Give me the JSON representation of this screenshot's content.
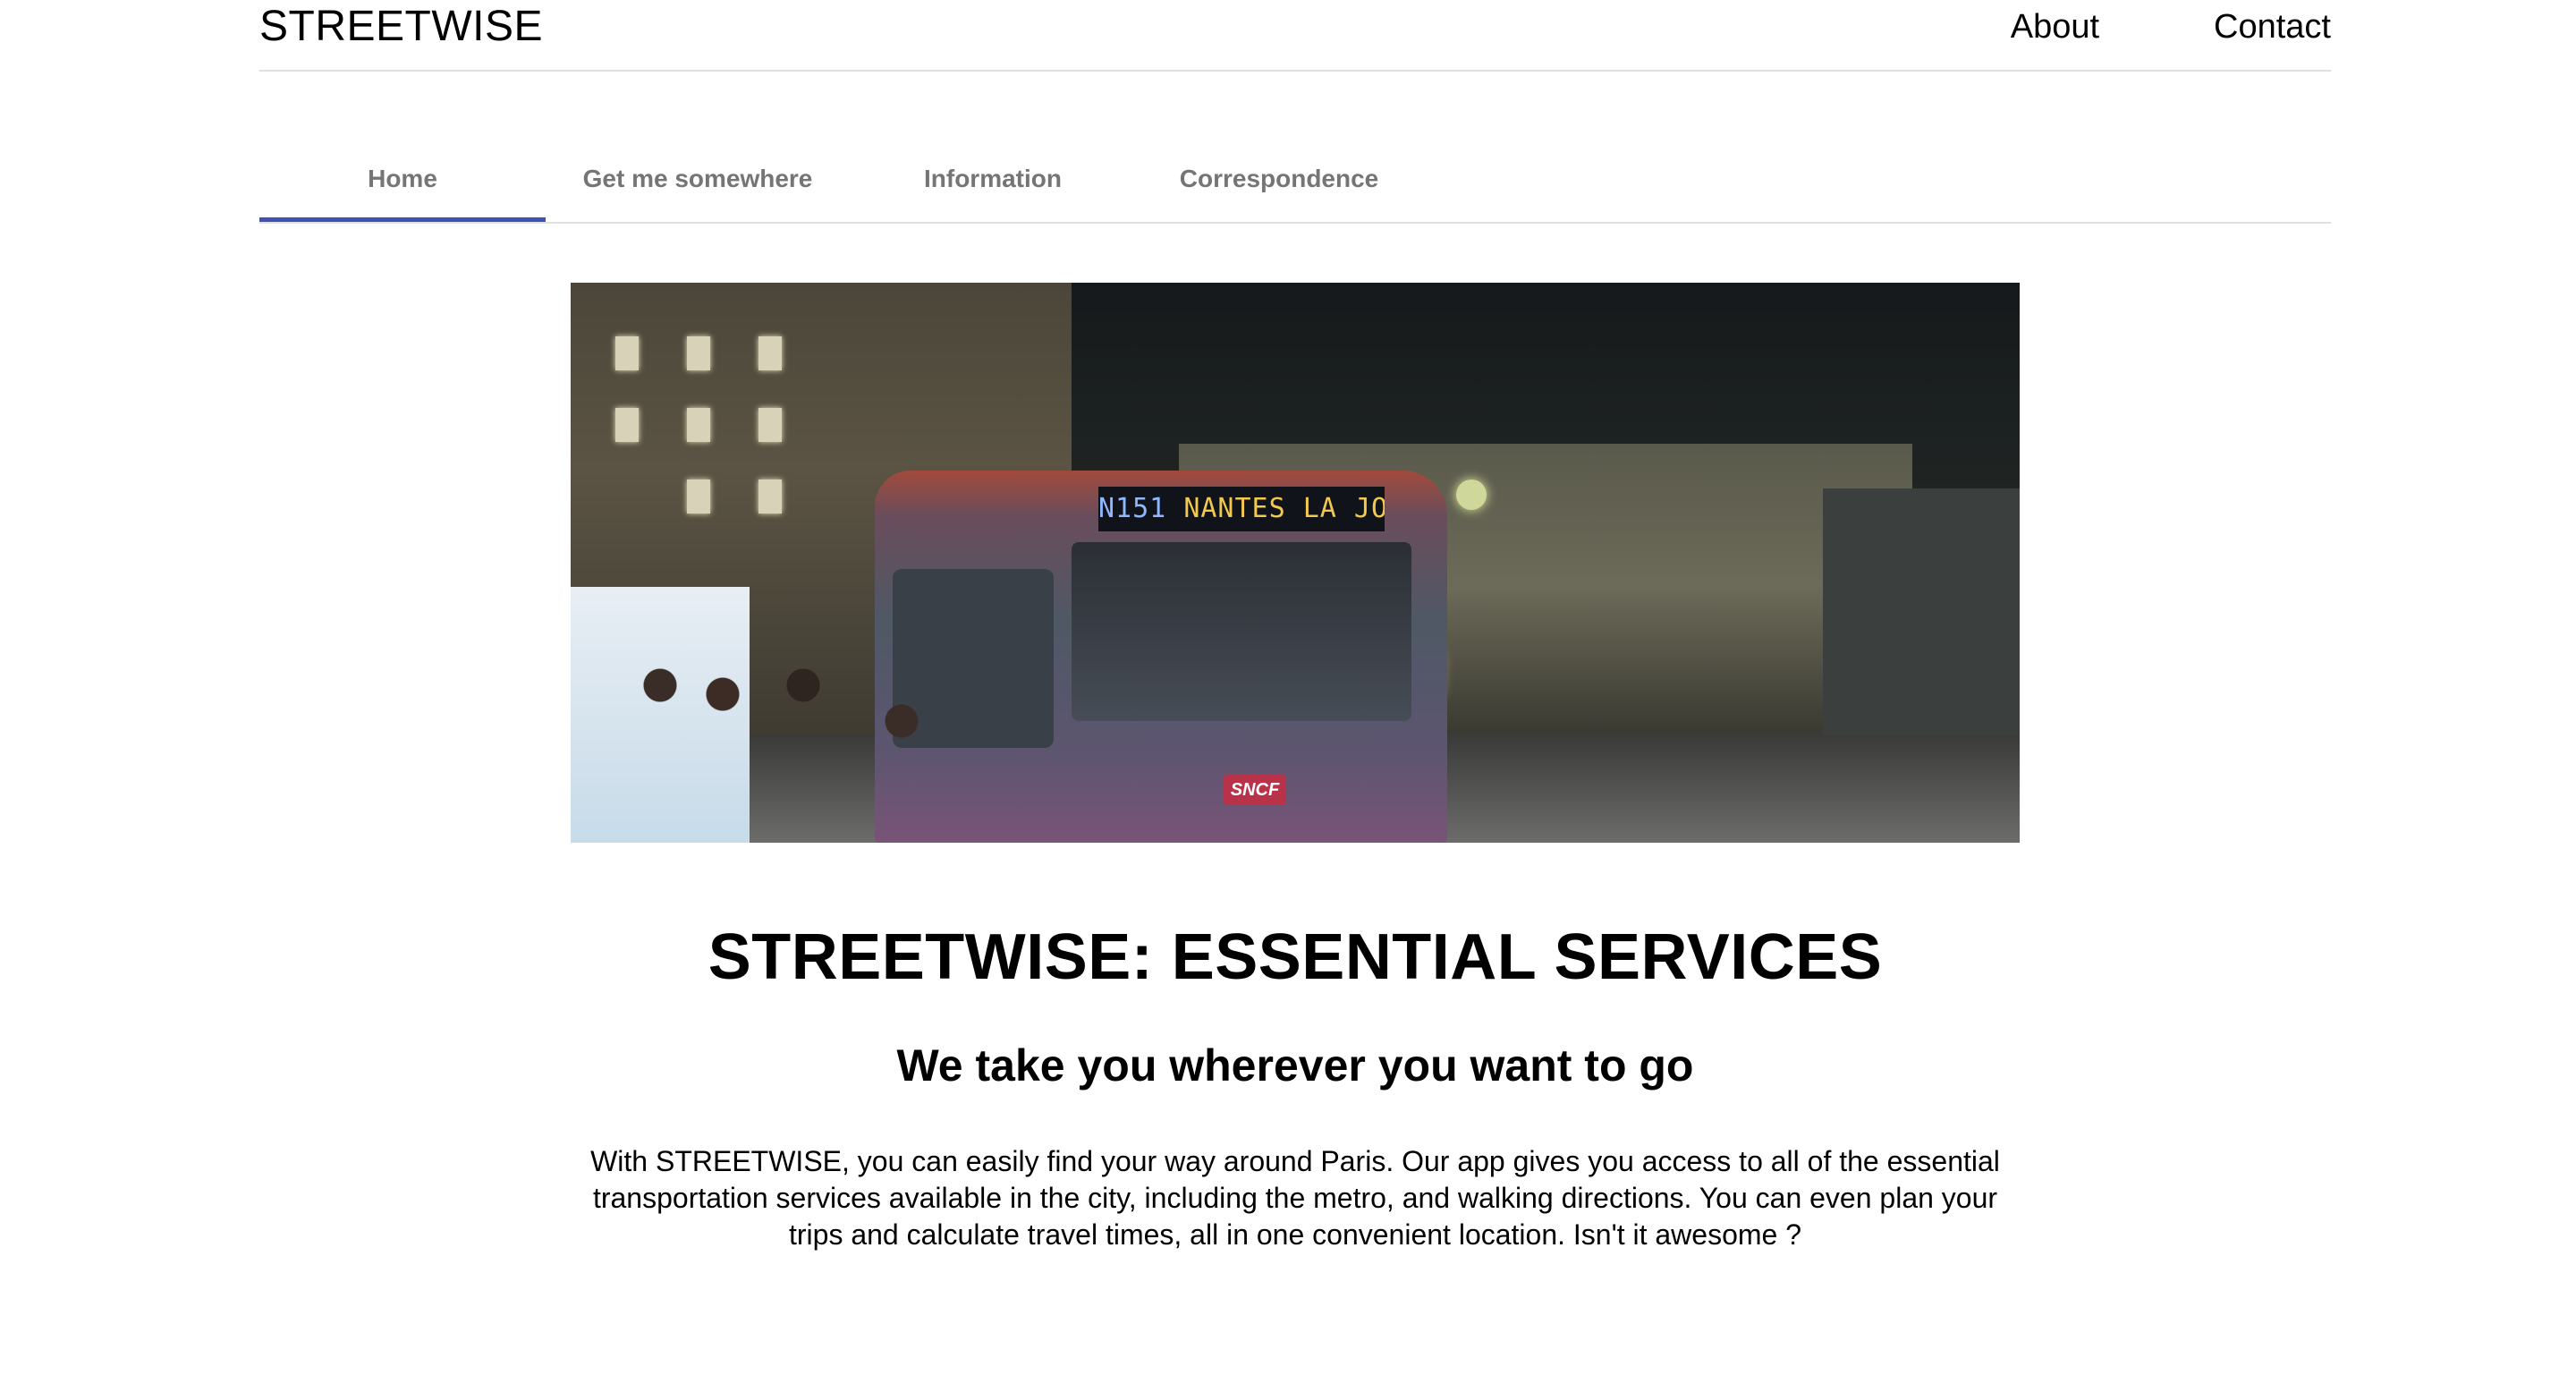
{
  "header": {
    "brand": "STREETWISE",
    "nav": [
      {
        "label": "About"
      },
      {
        "label": "Contact"
      }
    ]
  },
  "tabs": [
    {
      "label": "Home",
      "active": true
    },
    {
      "label": "Get me somewhere",
      "active": false
    },
    {
      "label": "Information",
      "active": false
    },
    {
      "label": "Correspondence",
      "active": false
    }
  ],
  "hero": {
    "bus_route": "N151",
    "bus_destination": "NANTES LA JOLIE",
    "bus_logo": "SNCF"
  },
  "main": {
    "title": "STREETWISE: ESSENTIAL SERVICES",
    "subtitle": "We take you wherever you want to go",
    "body": "With STREETWISE, you can easily find your way around Paris. Our app gives you access to all of the essential transportation services available in the city, including the metro, and walking directions. You can even plan your trips and calculate travel times, all in one convenient location. Isn't it awesome ?"
  },
  "colors": {
    "accent": "#3f51b5",
    "tab_text": "#757575",
    "divider": "#e0e0e0"
  }
}
